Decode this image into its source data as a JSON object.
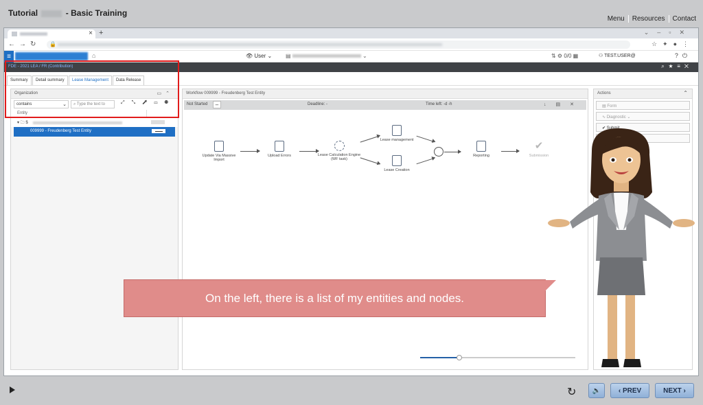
{
  "course": {
    "title_prefix": "Tutorial",
    "title_suffix": "- Basic Training",
    "nav": [
      "Menu",
      "Resources",
      "Contact"
    ],
    "prev_label": "PREV",
    "next_label": "NEXT"
  },
  "browser": {
    "tab_close": "×",
    "new_tab": "+"
  },
  "app": {
    "user_label": "User",
    "counter": "0/0",
    "user_name": "TEST.USER@",
    "breadcrumb": "FDE - 2021 LEA / FR (Contribution)"
  },
  "subtabs": [
    "Summary",
    "Detail summary",
    "Lease Management",
    "Data Release"
  ],
  "organization": {
    "title": "Organization",
    "filter_value": "contains",
    "search_placeholder": "Type the text to",
    "column_header": "Entity",
    "root_prefix": "$",
    "selected_entity": "009999 - Freudenberg Test Entity"
  },
  "workflow": {
    "title": "Workflow 009999 - Freudenberg Test Entity",
    "status": "Not Started",
    "deadline": "Deadline: -",
    "time_left": "Time left: -d -h",
    "nodes": {
      "import": "Update Via Massive Import",
      "errors": "Upload Errors",
      "engine": "Lease Calculation Engine (WF task)",
      "management": "Lease management",
      "creation": "Lease Creation",
      "reporting": "Reporting",
      "submission": "Submission"
    },
    "progress": 0.25
  },
  "actions": {
    "title": "Actions",
    "buttons": [
      "Form",
      "Diagnostic",
      "Submit"
    ]
  },
  "callout_text": "On the left, there is a list of my entities and nodes.",
  "colors": {
    "accent": "#1f6fc4",
    "highlight": "#e11b1b",
    "callout": "#e08c8a"
  }
}
